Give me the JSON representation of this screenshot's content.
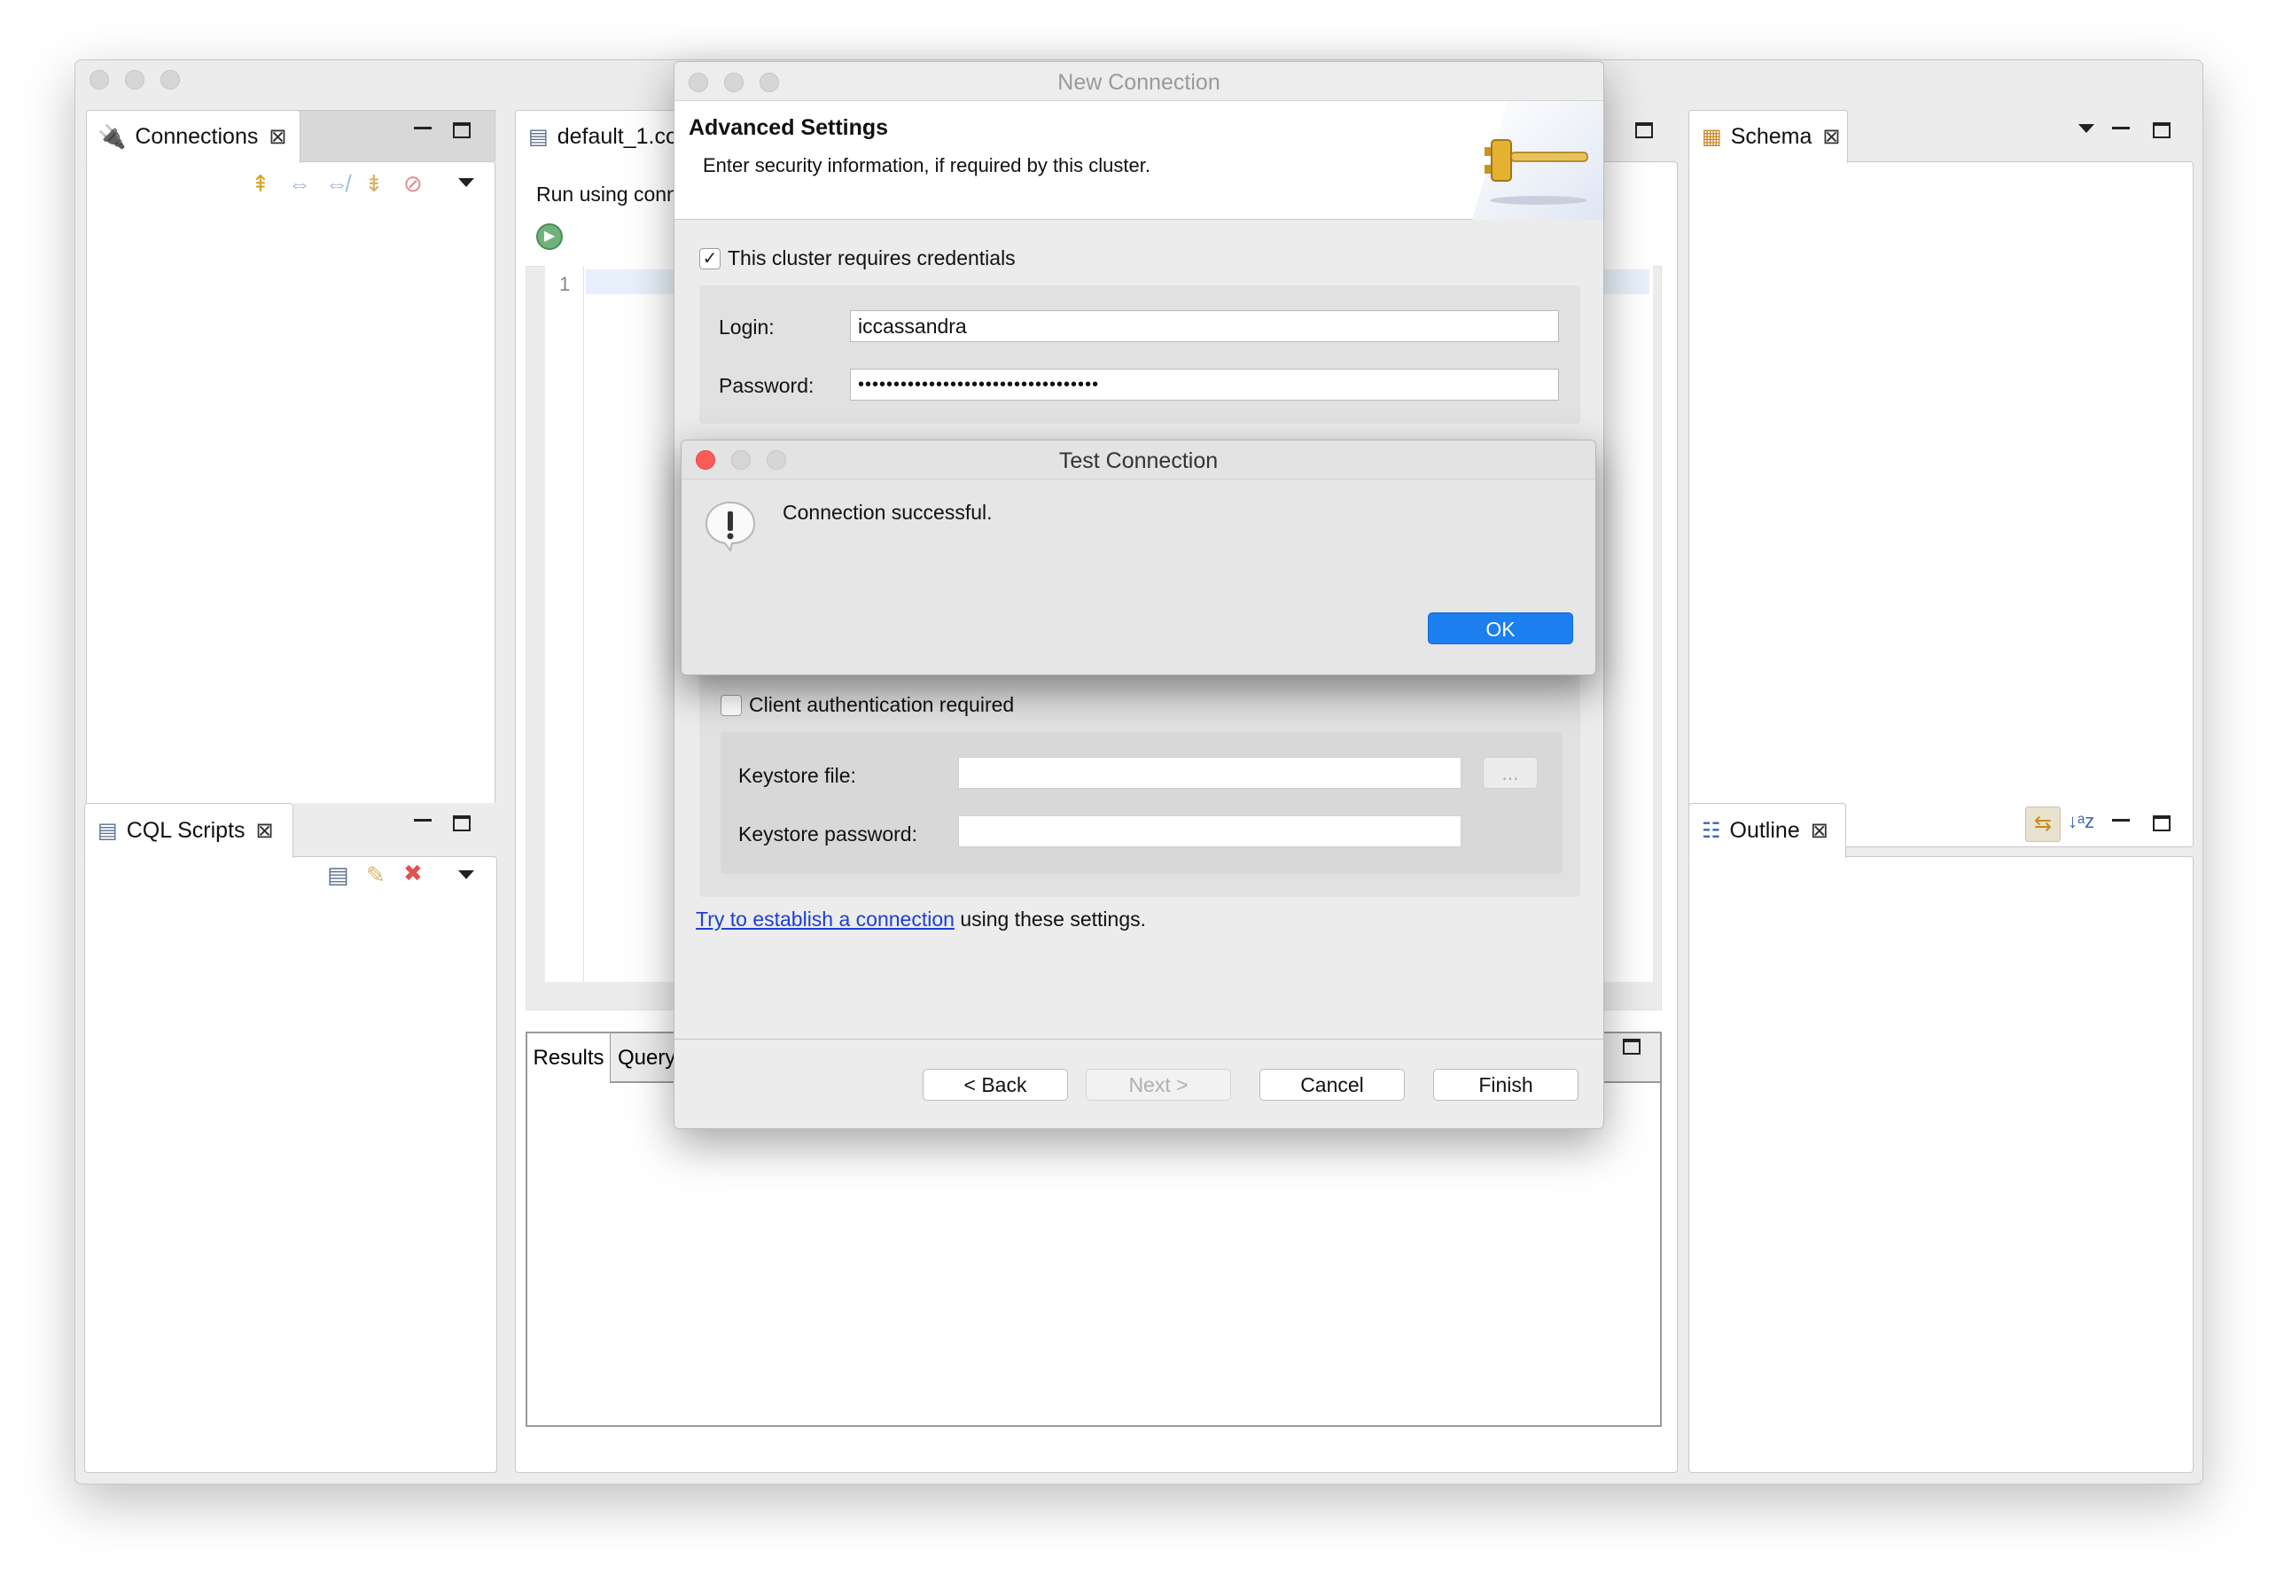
{
  "panels": {
    "connections": {
      "tab": "Connections"
    },
    "cql_scripts": {
      "tab": "CQL Scripts"
    },
    "editor": {
      "tab": "default_1.co",
      "run_label": "Run using conn",
      "line_number": "1"
    },
    "results": {
      "tab_results": "Results",
      "tab_query": "Query"
    },
    "schema": {
      "tab": "Schema"
    },
    "outline": {
      "tab": "Outline"
    }
  },
  "new_connection": {
    "title": "New Connection",
    "header_title": "Advanced Settings",
    "header_desc": "Enter security information, if required by this cluster.",
    "credentials_checkbox": "This cluster requires credentials",
    "credentials_checked": true,
    "login_label": "Login:",
    "login_value": "iccassandra",
    "password_label": "Password:",
    "password_value": "••••••••••••••••••••••••••••••••••",
    "client_auth_checkbox": "Client authentication required",
    "client_auth_checked": false,
    "keystore_file_label": "Keystore file:",
    "keystore_file_value": "",
    "browse_label": "...",
    "keystore_password_label": "Keystore password:",
    "keystore_password_value": "",
    "link_text": "Try to establish a connection",
    "link_suffix": "using these settings.",
    "buttons": {
      "back": "< Back",
      "next": "Next >",
      "cancel": "Cancel",
      "finish": "Finish"
    }
  },
  "test_connection": {
    "title": "Test Connection",
    "message": "Connection successful.",
    "ok": "OK"
  },
  "colors": {
    "accent_blue": "#1b7ff0",
    "link_blue": "#1a3fd6",
    "close_red": "#fc5b57"
  }
}
